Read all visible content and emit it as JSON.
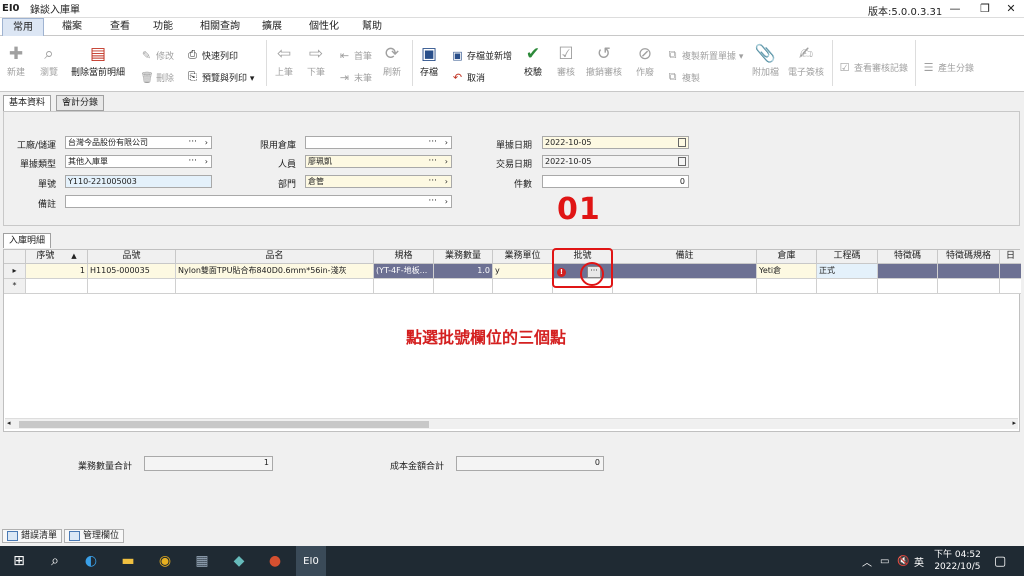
{
  "app": {
    "code": "EI0",
    "window_title": "錄談入庫單",
    "version": "版本:5.0.0.3.31"
  },
  "window_controls": {
    "minimize": "—",
    "restore": "❐",
    "close": "✕"
  },
  "menu": [
    "常用",
    "檔案",
    "查看",
    "功能",
    "相關查詢",
    "擴展",
    "個性化",
    "幫助"
  ],
  "ribbon": {
    "new": "新建",
    "browse": "瀏覽",
    "delete_current": "刪除當前明細",
    "modify": "修改",
    "delete": "刪除",
    "quick_print": "快速列印",
    "preview_print": "預覽與列印 ▾",
    "prev": "上筆",
    "next": "下筆",
    "first": "首筆",
    "last": "末筆",
    "refresh": "刷新",
    "save": "存檔",
    "save_new": "存檔並新增",
    "cancel": "取消",
    "verify": "校驗",
    "audit": "審核",
    "unaudit": "撤銷審核",
    "void": "作廢",
    "copy_new": "複製新置單據 ▾",
    "copy": "複製",
    "attach": "附加檔",
    "esign": "電子簽核",
    "view_log": "查看審核記錄",
    "gen_entry": "產生分錄"
  },
  "form_tabs": [
    "基本資料",
    "會計分錄"
  ],
  "form": {
    "factory_label": "工廠/儲運",
    "factory": "台灣今品股份有限公司",
    "doctype_label": "單據類型",
    "doctype": "其他入庫單",
    "docno_label": "單號",
    "docno": "Y110-221005003",
    "remark_label": "備註",
    "remark": "",
    "limit_wh_label": "限用倉庫",
    "limit_wh": "",
    "person_label": "人員",
    "person": "廖珮凱",
    "dept_label": "部門",
    "dept": "倉管",
    "docdate_label": "單據日期",
    "docdate": "2022-10-05",
    "txdate_label": "交易日期",
    "txdate": "2022-10-05",
    "pieces_label": "件數",
    "pieces": "0",
    "dots": "···",
    "arrow": "›"
  },
  "annotation": {
    "step": "01",
    "instruction": "點選批號欄位的三個點"
  },
  "grid_tab": "入庫明細",
  "grid": {
    "columns": [
      "序號",
      "品號",
      "品名",
      "規格",
      "業務數量",
      "業務單位",
      "批號",
      "備註",
      "倉庫",
      "工程碼",
      "特徵碼",
      "特徵碼規格",
      "日"
    ],
    "sort_arrow": "▲",
    "rows": [
      {
        "seq": "1",
        "item_no": "H1105-000035",
        "item_name": "Nylon雙面TPU貼合布840D0.6mm*56in-淺灰",
        "spec": "(YT-4F-地板...",
        "qty": "1.0",
        "unit": "y",
        "lot": "",
        "remark": "",
        "warehouse": "Yeti倉",
        "proj": "正式",
        "feat": "",
        "feat_spec": ""
      }
    ],
    "row_pointer": "▸",
    "new_row_marker": "*",
    "error_mark": "!",
    "cell_dots": "···"
  },
  "totals": {
    "qty_label": "業務數量合計",
    "qty": "1",
    "cost_label": "成本金額合計",
    "cost": "0"
  },
  "bottom_tabs": [
    "錯誤清單",
    "管理欄位"
  ],
  "taskbar": {
    "active_app": "EI0",
    "tray_lang": "英",
    "time": "下午 04:52",
    "date": "2022/10/5"
  }
}
